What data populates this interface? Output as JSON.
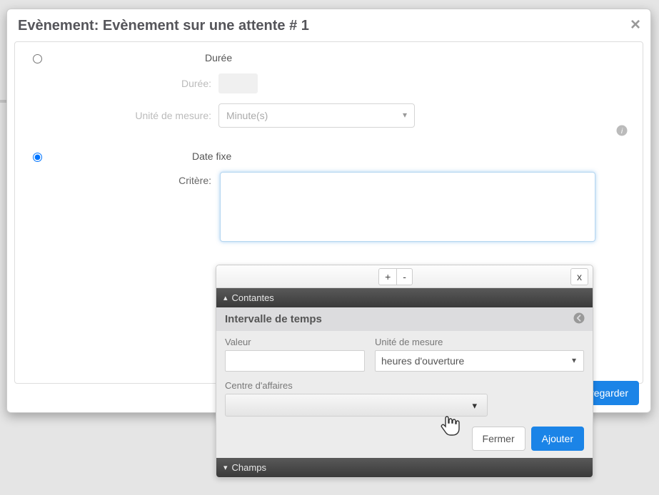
{
  "modal": {
    "title": "Evènement: Evènement sur une attente # 1",
    "radio_duration_label": "Durée",
    "duration_field_label": "Durée:",
    "unit_field_label": "Unité de mesure:",
    "unit_value": "Minute(s)",
    "radio_fixed_label": "Date fixe",
    "criteria_label": "Critère:",
    "footer_button": "Sauvegarder"
  },
  "popup": {
    "toolbar": {
      "plus": "+",
      "minus": "-",
      "close": "x"
    },
    "accordion_constants": "Contantes",
    "accordion_fields": "Champs",
    "panel_title": "Intervalle de temps",
    "value_label": "Valeur",
    "unit_label": "Unité de mesure",
    "unit_value": "heures d'ouverture",
    "center_label": "Centre d'affaires",
    "btn_close": "Fermer",
    "btn_add": "Ajouter"
  }
}
